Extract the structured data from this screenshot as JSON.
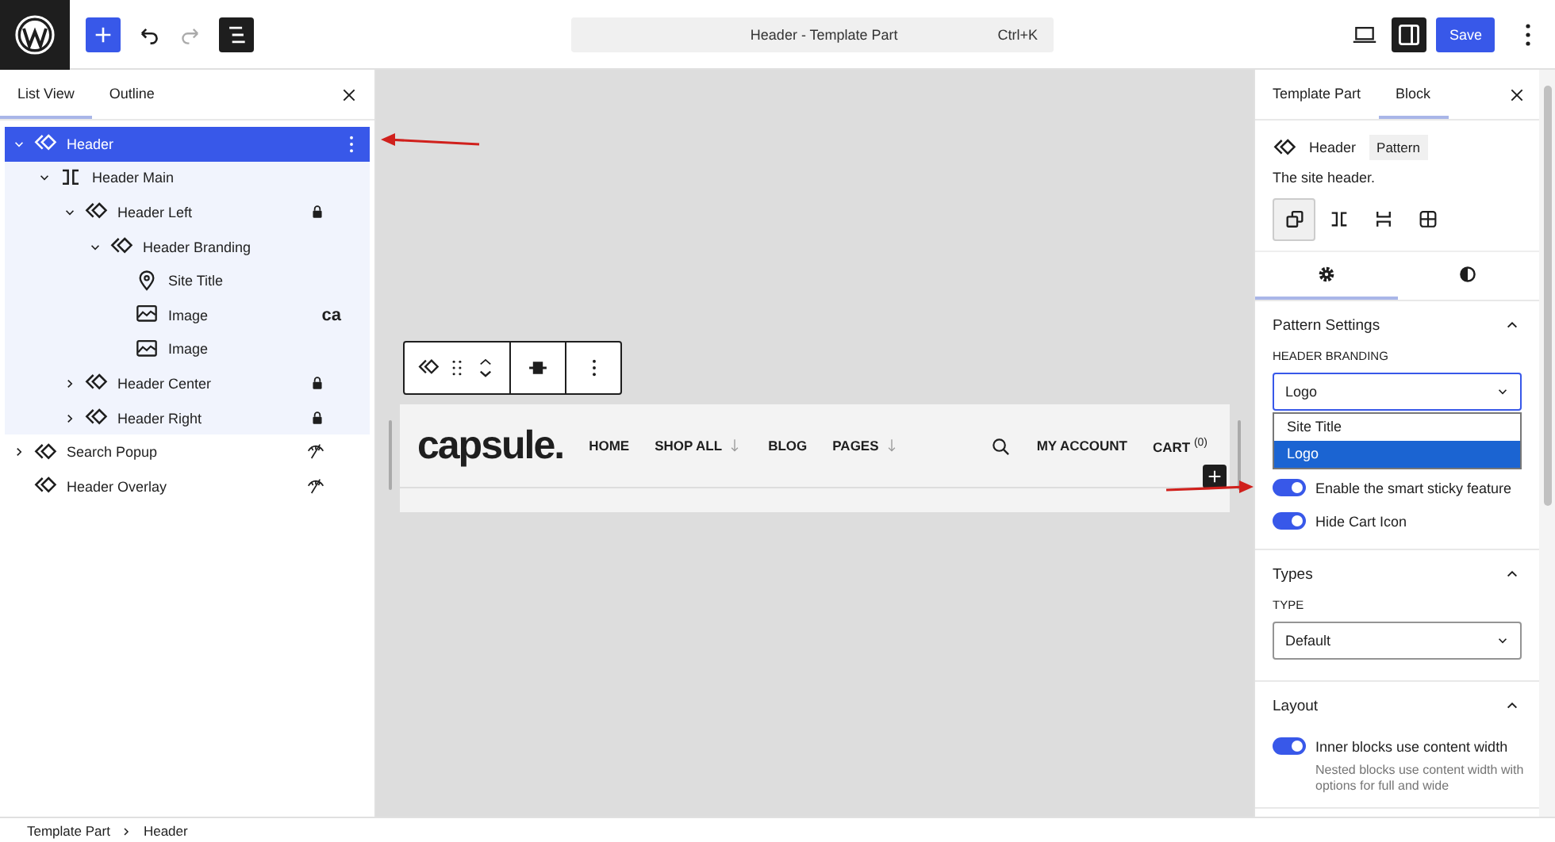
{
  "toolbar": {
    "title": "Header - Template Part",
    "shortcut": "Ctrl+K",
    "save": "Save",
    "list_view_on": true,
    "sidebar_on": true
  },
  "list_panel": {
    "tabs": [
      {
        "label": "List View",
        "selected": true
      },
      {
        "label": "Outline",
        "selected": false
      }
    ],
    "tree": [
      {
        "label": "Header",
        "kind": "pattern",
        "selected": true,
        "expanded": true,
        "locked": false,
        "hidden": false,
        "children": [
          {
            "label": "Header Main",
            "kind": "row",
            "selected": false,
            "expanded": true,
            "locked": false,
            "hidden": false,
            "children": [
              {
                "label": "Header Left",
                "kind": "pattern",
                "selected": false,
                "expanded": true,
                "locked": true,
                "hidden": false,
                "children": [
                  {
                    "label": "Header Branding",
                    "kind": "pattern",
                    "selected": false,
                    "expanded": true,
                    "locked": false,
                    "hidden": false,
                    "children": [
                      {
                        "label": "Site Title",
                        "kind": "pin",
                        "selected": false,
                        "locked": false,
                        "hidden": false
                      },
                      {
                        "label": "Image",
                        "kind": "image",
                        "selected": false,
                        "locked": false,
                        "hidden": false,
                        "preview": "ca"
                      },
                      {
                        "label": "Image",
                        "kind": "image",
                        "selected": false,
                        "locked": false,
                        "hidden": false
                      }
                    ]
                  }
                ]
              },
              {
                "label": "Header Center",
                "kind": "pattern",
                "selected": false,
                "expanded": false,
                "locked": true,
                "hidden": false
              },
              {
                "label": "Header Right",
                "kind": "pattern",
                "selected": false,
                "expanded": false,
                "locked": true,
                "hidden": false
              }
            ]
          }
        ]
      },
      {
        "label": "Search Popup",
        "kind": "pattern",
        "selected": false,
        "expanded": false,
        "locked": false,
        "hidden": true
      },
      {
        "label": "Header Overlay",
        "kind": "pattern",
        "selected": false,
        "locked": false,
        "hidden": true
      }
    ]
  },
  "canvas": {
    "logo": "capsule.",
    "nav": [
      {
        "label": "HOME",
        "submenu": false
      },
      {
        "label": "SHOP ALL",
        "submenu": true
      },
      {
        "label": "BLOG",
        "submenu": false
      },
      {
        "label": "PAGES",
        "submenu": true
      }
    ],
    "account": "MY ACCOUNT",
    "cart": "CART $^{(0)}$"
  },
  "inspector": {
    "tabs": [
      {
        "label": "Template Part",
        "selected": false
      },
      {
        "label": "Block",
        "selected": true
      }
    ],
    "block": {
      "name": "Header",
      "badge": "Pattern",
      "description": "The site header."
    },
    "styles": [
      {
        "kind": "default",
        "selected": true
      },
      {
        "kind": "row",
        "selected": false
      },
      {
        "kind": "stack",
        "selected": false
      },
      {
        "kind": "grid",
        "selected": false
      }
    ],
    "subtabs": [
      {
        "kind": "settings",
        "selected": true
      },
      {
        "kind": "styles",
        "selected": false
      }
    ],
    "panels": [
      {
        "title": "Pattern Settings",
        "expanded": true,
        "controls": [
          {
            "kind": "select",
            "label": "HEADER BRANDING",
            "value": "Logo",
            "open": true,
            "options": [
              {
                "label": "Site Title",
                "selected": false
              },
              {
                "label": "Logo",
                "selected": true
              }
            ]
          },
          {
            "kind": "toggle",
            "label": "Enable the smart sticky feature",
            "on": true
          },
          {
            "kind": "toggle",
            "label": "Hide Cart Icon",
            "on": true
          }
        ]
      },
      {
        "title": "Types",
        "expanded": true,
        "controls": [
          {
            "kind": "select",
            "label": "TYPE",
            "value": "Default",
            "open": false
          }
        ]
      },
      {
        "title": "Layout",
        "expanded": true,
        "controls": [
          {
            "kind": "toggle",
            "label": "Inner blocks use content width",
            "on": true,
            "help": "Nested blocks use content width with options for full and wide"
          }
        ]
      }
    ]
  },
  "breadcrumb": [
    "Template Part",
    "Header"
  ]
}
